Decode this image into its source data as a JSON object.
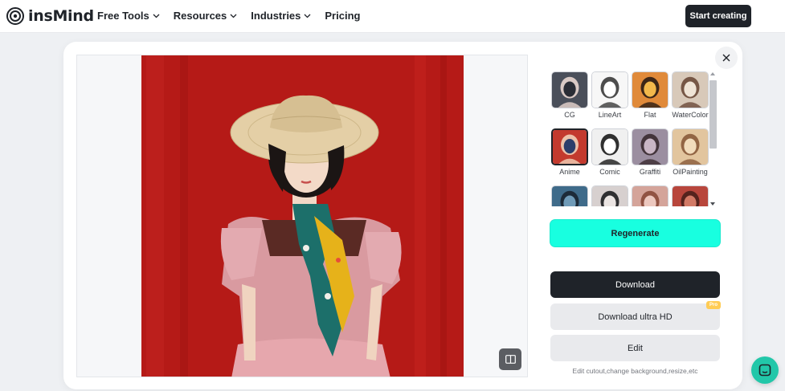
{
  "brand": {
    "name": "insMind"
  },
  "nav": [
    {
      "label": "Free Tools",
      "dropdown": true
    },
    {
      "label": "Resources",
      "dropdown": true
    },
    {
      "label": "Industries",
      "dropdown": true
    },
    {
      "label": "Pricing",
      "dropdown": false
    }
  ],
  "header": {
    "cta_label": "Start creating"
  },
  "styles": [
    {
      "label": "CG",
      "selected": false
    },
    {
      "label": "LineArt",
      "selected": false
    },
    {
      "label": "Flat",
      "selected": false
    },
    {
      "label": "WaterColor",
      "selected": false
    },
    {
      "label": "Anime",
      "selected": true
    },
    {
      "label": "Comic",
      "selected": false
    },
    {
      "label": "Graffiti",
      "selected": false
    },
    {
      "label": "OilPainting",
      "selected": false
    },
    {
      "label": "",
      "selected": false
    },
    {
      "label": "",
      "selected": false
    },
    {
      "label": "",
      "selected": false
    },
    {
      "label": "",
      "selected": false
    }
  ],
  "actions": {
    "regenerate_label": "Regenerate",
    "download_label": "Download",
    "download_hd_label": "Download ultra HD",
    "pro_badge": "Pro",
    "edit_label": "Edit",
    "edit_hint": "Edit cutout,change background,resize,etc"
  },
  "colors": {
    "accent": "#18ffe0",
    "dark": "#1f2329",
    "chat": "#22c7a9",
    "artwork_background": "#b51a17"
  },
  "icons": {
    "close": "close-icon",
    "compare": "compare-icon",
    "chat": "chat-icon"
  }
}
